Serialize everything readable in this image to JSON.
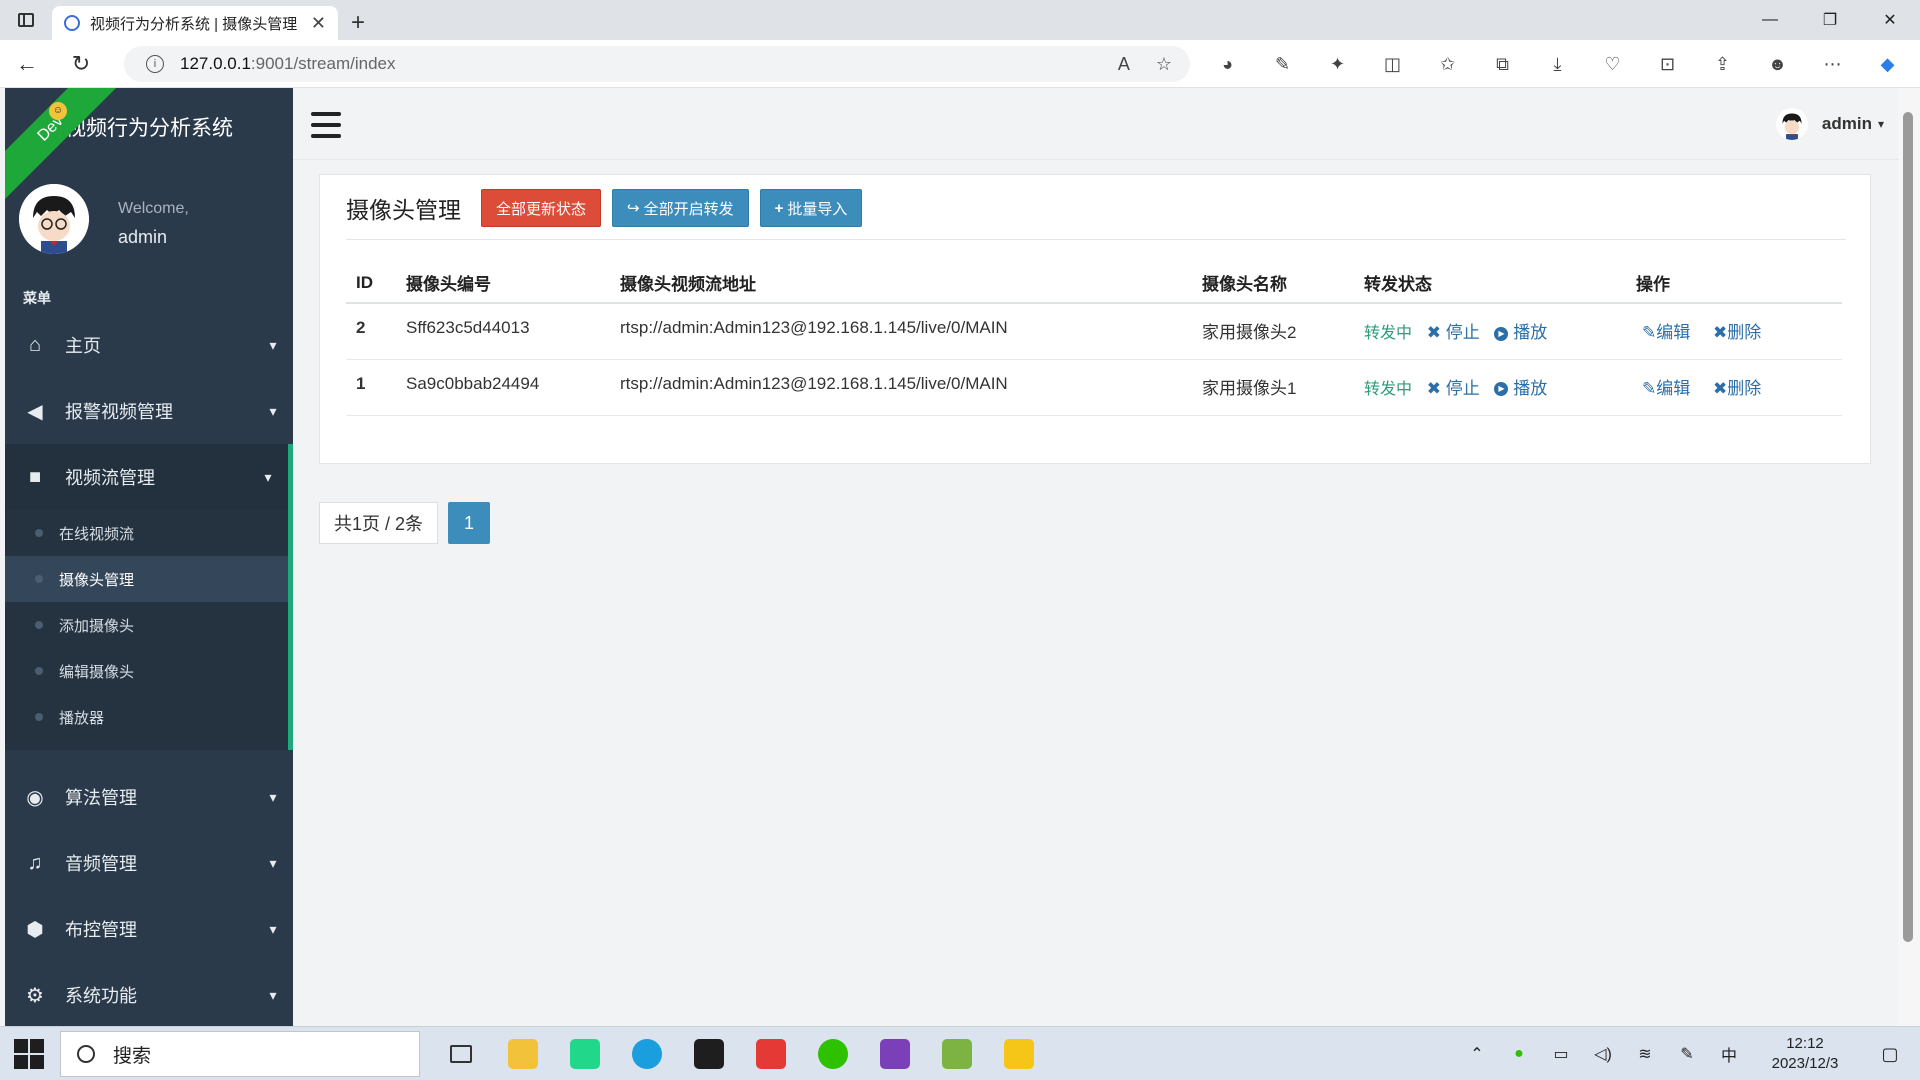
{
  "browser": {
    "tab_title": "视频行为分析系统 | 摄像头管理",
    "url_host": "127.0.0.1",
    "url_path": ":9001/stream/index"
  },
  "app": {
    "title": "视频行为分析系统",
    "dev_ribbon": "Dev",
    "welcome": "Welcome,",
    "username": "admin",
    "menu_label": "菜单"
  },
  "sidebar": {
    "items": [
      {
        "label": "主页",
        "icon": "home-icon",
        "glyph": "⌂"
      },
      {
        "label": "报警视频管理",
        "icon": "bullhorn-icon",
        "glyph": "📢"
      },
      {
        "label": "视频流管理",
        "icon": "video-camera-icon",
        "glyph": "■"
      },
      {
        "label": "算法管理",
        "icon": "eye-icon",
        "glyph": "◉"
      },
      {
        "label": "音频管理",
        "icon": "music-icon",
        "glyph": "♫"
      },
      {
        "label": "布控管理",
        "icon": "cube-icon",
        "glyph": "⬢"
      },
      {
        "label": "系统功能",
        "icon": "gear-icon",
        "glyph": "⚙"
      }
    ],
    "sub_items": [
      {
        "label": "在线视频流"
      },
      {
        "label": "摄像头管理"
      },
      {
        "label": "添加摄像头"
      },
      {
        "label": "编辑摄像头"
      },
      {
        "label": "播放器"
      }
    ]
  },
  "topbar": {
    "user": "admin"
  },
  "card": {
    "title": "摄像头管理",
    "btn_update_all": "全部更新状态",
    "btn_forward_all": "全部开启转发",
    "btn_import": "批量导入"
  },
  "table": {
    "headers": [
      "ID",
      "摄像头编号",
      "摄像头视频流地址",
      "摄像头名称",
      "转发状态",
      "操作"
    ],
    "rows": [
      {
        "id": "2",
        "code": "Sff623c5d44013",
        "url": "rtsp://admin:Admin123@192.168.1.145/live/0/MAIN",
        "name": "家用摄像头2",
        "status": "转发中",
        "stop": "停止",
        "play": "播放",
        "edit": "编辑",
        "delete": "删除"
      },
      {
        "id": "1",
        "code": "Sa9c0bbab24494",
        "url": "rtsp://admin:Admin123@192.168.1.145/live/0/MAIN",
        "name": "家用摄像头1",
        "status": "转发中",
        "stop": "停止",
        "play": "播放",
        "edit": "编辑",
        "delete": "删除"
      }
    ]
  },
  "pager": {
    "info": "共1页 / 2条",
    "current_page": "1"
  },
  "taskbar": {
    "search_placeholder": "搜索",
    "ime": "中",
    "time": "12:12",
    "date": "2023/12/3"
  }
}
